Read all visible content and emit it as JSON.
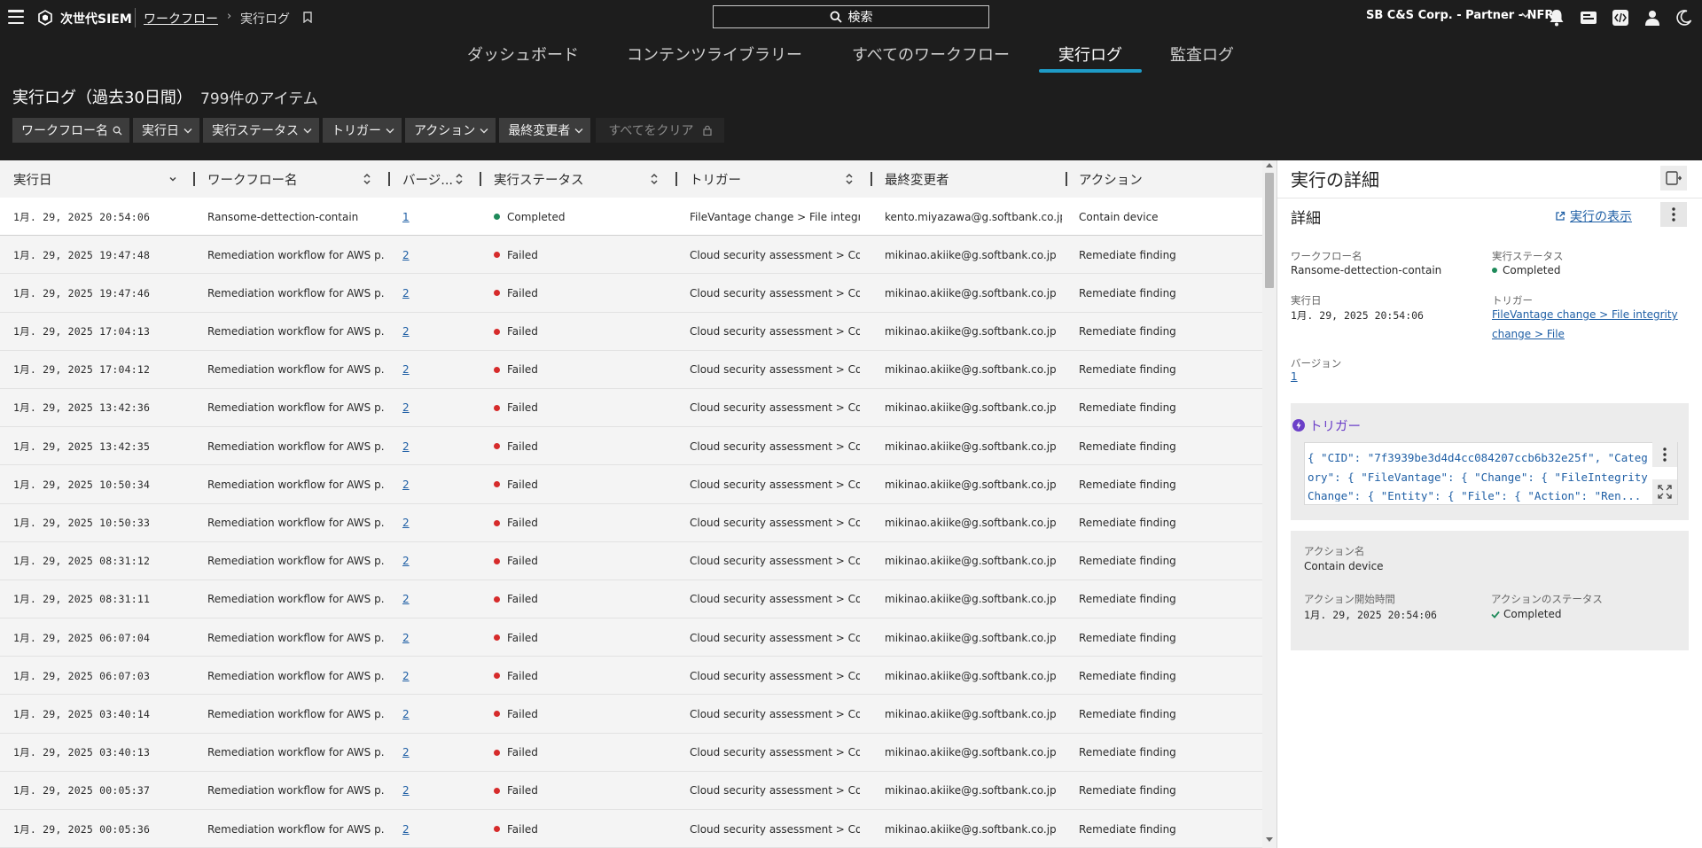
{
  "topbar": {
    "brand": "次世代SIEM",
    "breadcrumb_link": "ワークフロー",
    "breadcrumb_sep": "›",
    "breadcrumb_current": "実行ログ",
    "search_label": "検索",
    "account": "SB C&S Corp. - Partner - NFR"
  },
  "nav": {
    "tabs": [
      {
        "label": "ダッシュボード",
        "active": false
      },
      {
        "label": "コンテンツライブラリー",
        "active": false
      },
      {
        "label": "すべてのワークフロー",
        "active": false
      },
      {
        "label": "実行ログ",
        "active": true
      },
      {
        "label": "監査ログ",
        "active": false
      }
    ]
  },
  "header": {
    "title": "実行ログ（過去30日間）",
    "count": "799件のアイテム"
  },
  "filters": {
    "items": [
      "ワークフロー名",
      "実行日",
      "実行ステータス",
      "トリガー",
      "アクション",
      "最終変更者"
    ],
    "clear_label": "すべてをクリア"
  },
  "table": {
    "columns": [
      "実行日",
      "ワークフロー名",
      "バージ...",
      "実行ステータス",
      "トリガー",
      "最終変更者",
      "アクション"
    ],
    "rows": [
      {
        "date": "1月. 29, 2025 20:54:06",
        "workflow": "Ransome-dettection-contain",
        "version": "1",
        "status": "Completed",
        "trigger": "FileVantage change > File integri...",
        "user": "kento.miyazawa@g.softbank.co.jp",
        "action": "Contain device"
      },
      {
        "date": "1月. 29, 2025 19:47:48",
        "workflow": "Remediation workflow for AWS p...",
        "version": "2",
        "status": "Failed",
        "trigger": "Cloud security assessment > Co...",
        "user": "mikinao.akiike@g.softbank.co.jp",
        "action": "Remediate finding"
      },
      {
        "date": "1月. 29, 2025 19:47:46",
        "workflow": "Remediation workflow for AWS p...",
        "version": "2",
        "status": "Failed",
        "trigger": "Cloud security assessment > Co...",
        "user": "mikinao.akiike@g.softbank.co.jp",
        "action": "Remediate finding"
      },
      {
        "date": "1月. 29, 2025 17:04:13",
        "workflow": "Remediation workflow for AWS p...",
        "version": "2",
        "status": "Failed",
        "trigger": "Cloud security assessment > Co...",
        "user": "mikinao.akiike@g.softbank.co.jp",
        "action": "Remediate finding"
      },
      {
        "date": "1月. 29, 2025 17:04:12",
        "workflow": "Remediation workflow for AWS p...",
        "version": "2",
        "status": "Failed",
        "trigger": "Cloud security assessment > Co...",
        "user": "mikinao.akiike@g.softbank.co.jp",
        "action": "Remediate finding"
      },
      {
        "date": "1月. 29, 2025 13:42:36",
        "workflow": "Remediation workflow for AWS p...",
        "version": "2",
        "status": "Failed",
        "trigger": "Cloud security assessment > Co...",
        "user": "mikinao.akiike@g.softbank.co.jp",
        "action": "Remediate finding"
      },
      {
        "date": "1月. 29, 2025 13:42:35",
        "workflow": "Remediation workflow for AWS p...",
        "version": "2",
        "status": "Failed",
        "trigger": "Cloud security assessment > Co...",
        "user": "mikinao.akiike@g.softbank.co.jp",
        "action": "Remediate finding"
      },
      {
        "date": "1月. 29, 2025 10:50:34",
        "workflow": "Remediation workflow for AWS p...",
        "version": "2",
        "status": "Failed",
        "trigger": "Cloud security assessment > Co...",
        "user": "mikinao.akiike@g.softbank.co.jp",
        "action": "Remediate finding"
      },
      {
        "date": "1月. 29, 2025 10:50:33",
        "workflow": "Remediation workflow for AWS p...",
        "version": "2",
        "status": "Failed",
        "trigger": "Cloud security assessment > Co...",
        "user": "mikinao.akiike@g.softbank.co.jp",
        "action": "Remediate finding"
      },
      {
        "date": "1月. 29, 2025 08:31:12",
        "workflow": "Remediation workflow for AWS p...",
        "version": "2",
        "status": "Failed",
        "trigger": "Cloud security assessment > Co...",
        "user": "mikinao.akiike@g.softbank.co.jp",
        "action": "Remediate finding"
      },
      {
        "date": "1月. 29, 2025 08:31:11",
        "workflow": "Remediation workflow for AWS p...",
        "version": "2",
        "status": "Failed",
        "trigger": "Cloud security assessment > Co...",
        "user": "mikinao.akiike@g.softbank.co.jp",
        "action": "Remediate finding"
      },
      {
        "date": "1月. 29, 2025 06:07:04",
        "workflow": "Remediation workflow for AWS p...",
        "version": "2",
        "status": "Failed",
        "trigger": "Cloud security assessment > Co...",
        "user": "mikinao.akiike@g.softbank.co.jp",
        "action": "Remediate finding"
      },
      {
        "date": "1月. 29, 2025 06:07:03",
        "workflow": "Remediation workflow for AWS p...",
        "version": "2",
        "status": "Failed",
        "trigger": "Cloud security assessment > Co...",
        "user": "mikinao.akiike@g.softbank.co.jp",
        "action": "Remediate finding"
      },
      {
        "date": "1月. 29, 2025 03:40:14",
        "workflow": "Remediation workflow for AWS p...",
        "version": "2",
        "status": "Failed",
        "trigger": "Cloud security assessment > Co...",
        "user": "mikinao.akiike@g.softbank.co.jp",
        "action": "Remediate finding"
      },
      {
        "date": "1月. 29, 2025 03:40:13",
        "workflow": "Remediation workflow for AWS p...",
        "version": "2",
        "status": "Failed",
        "trigger": "Cloud security assessment > Co...",
        "user": "mikinao.akiike@g.softbank.co.jp",
        "action": "Remediate finding"
      },
      {
        "date": "1月. 29, 2025 00:05:37",
        "workflow": "Remediation workflow for AWS p...",
        "version": "2",
        "status": "Failed",
        "trigger": "Cloud security assessment > Co...",
        "user": "mikinao.akiike@g.softbank.co.jp",
        "action": "Remediate finding"
      },
      {
        "date": "1月. 29, 2025 00:05:36",
        "workflow": "Remediation workflow for AWS p...",
        "version": "2",
        "status": "Failed",
        "trigger": "Cloud security assessment > Co...",
        "user": "mikinao.akiike@g.softbank.co.jp",
        "action": "Remediate finding"
      }
    ]
  },
  "panel": {
    "title": "実行の詳細",
    "section_title": "詳細",
    "view_link": "実行の表示",
    "workflow_label": "ワークフロー名",
    "workflow_value": "Ransome-dettection-contain",
    "status_label": "実行ステータス",
    "status_value": "Completed",
    "date_label": "実行日",
    "date_value": "1月. 29, 2025 20:54:06",
    "trigger_label": "トリガー",
    "trigger_value": "FileVantage change > File integrity change > File",
    "version_label": "バージョン",
    "version_value": "1",
    "trigger_card_title": "トリガー",
    "trigger_code": "{ \"CID\": \"7f3939be3d4d4cc084207ccb6b32e25f\", \"Category\": { \"FileVantage\": { \"Change\": { \"FileIntegrityChange\": { \"Entity\": { \"File\": { \"Action\": \"Ren...",
    "action_name_label": "アクション名",
    "action_name_value": "Contain device",
    "action_start_label": "アクション開始時間",
    "action_start_value": "1月. 29, 2025 20:54:06",
    "action_status_label": "アクションのステータス",
    "action_status_value": "Completed"
  },
  "colors": {
    "accent": "#1e9bc7",
    "completed": "#1e8a5a",
    "failed": "#d62b2b",
    "link": "#1f5fa5",
    "trigger_purple": "#6b3fc8"
  }
}
